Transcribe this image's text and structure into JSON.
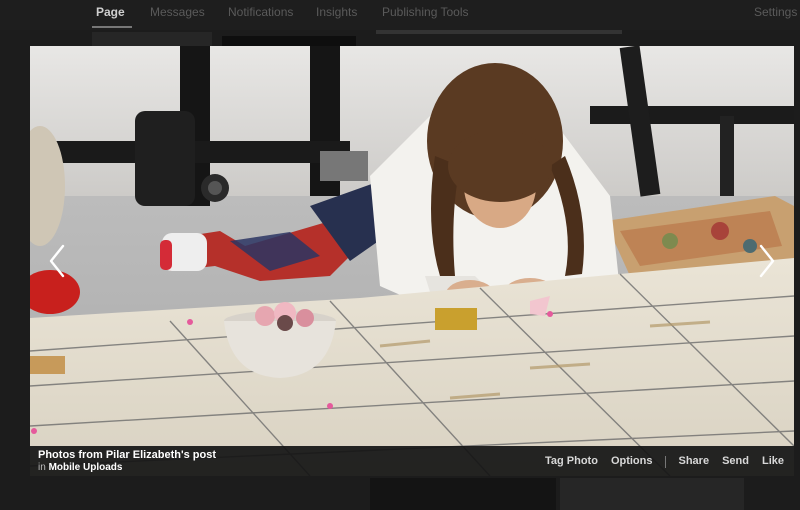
{
  "tabs": [
    {
      "label": "Page"
    },
    {
      "label": "Messages"
    },
    {
      "label": "Notifications"
    },
    {
      "label": "Insights"
    },
    {
      "label": "Publishing Tools"
    },
    {
      "label": "Settings"
    }
  ],
  "caption": {
    "title": "Photos from Pilar Elizabeth's post",
    "in_label": "in",
    "album": "Mobile Uploads"
  },
  "actions": {
    "tag_photo": "Tag Photo",
    "options": "Options",
    "share": "Share",
    "send": "Send",
    "like": "Like"
  },
  "icons": {
    "prev": "chevron-left-icon",
    "next": "chevron-right-icon"
  }
}
